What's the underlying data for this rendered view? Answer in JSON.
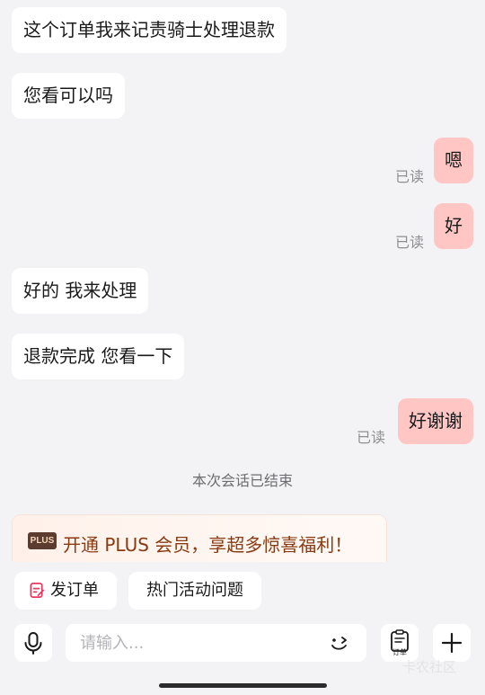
{
  "messages": [
    {
      "from": "agent",
      "text": "这个订单我来记责骑士处理退款"
    },
    {
      "from": "agent",
      "text": "您看可以吗"
    },
    {
      "from": "user",
      "text": "嗯",
      "status": "已读"
    },
    {
      "from": "user",
      "text": "好",
      "status": "已读"
    },
    {
      "from": "agent",
      "text": "好的 我来处理"
    },
    {
      "from": "agent",
      "text": "退款完成 您看一下"
    },
    {
      "from": "user",
      "text": "好谢谢",
      "status": "已读"
    }
  ],
  "session_ended": "本次会话已结束",
  "plus_banner": {
    "badge": "PLUS",
    "text": "开通 PLUS 会员，享超多惊喜福利！"
  },
  "quick_actions": {
    "send_order": "发订单",
    "hot_questions": "热门活动问题"
  },
  "input": {
    "placeholder": "请输入..."
  },
  "toolbar": {
    "order_label": "订单"
  },
  "watermark": "卡农社区",
  "colors": {
    "outgoing_bubble": "#ffc6c4",
    "incoming_bubble": "#ffffff",
    "plus_text": "#8a3a10",
    "background": "#f3f3f6"
  }
}
